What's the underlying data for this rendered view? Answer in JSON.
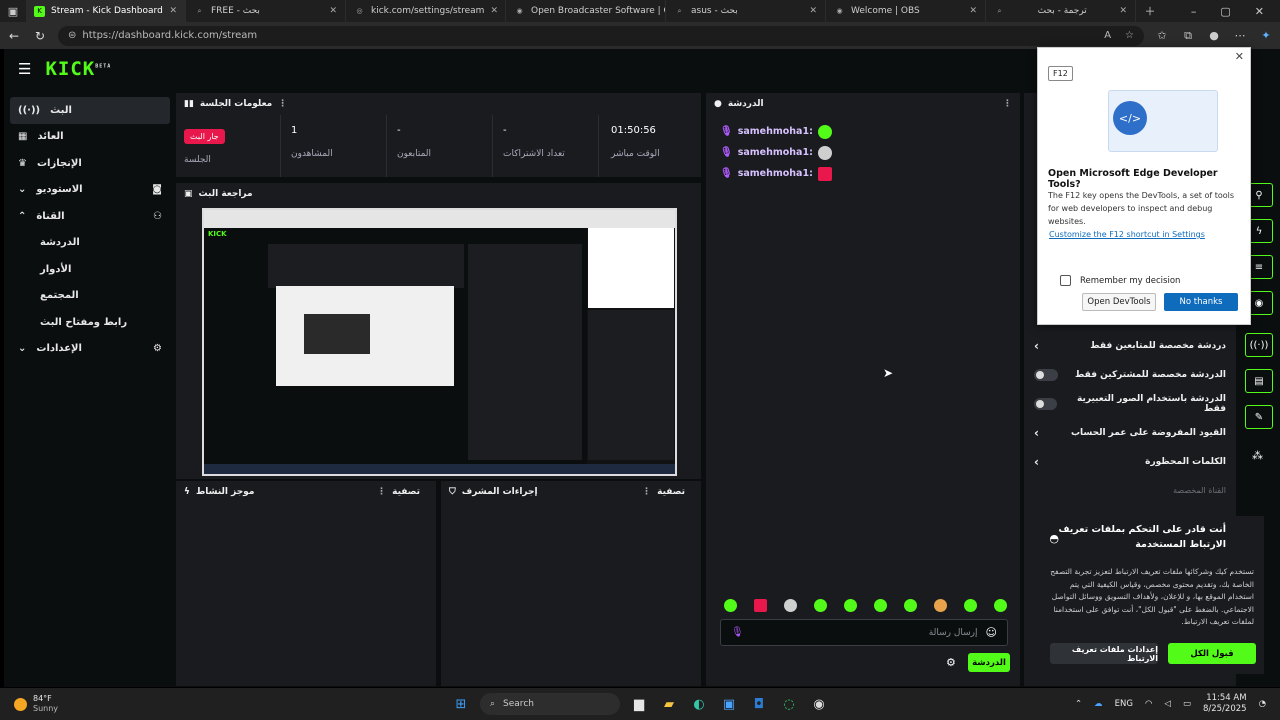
{
  "browser": {
    "tabs": [
      {
        "title": "Stream - Kick Dashboard",
        "favicon": "kick",
        "active": true
      },
      {
        "title": "FREE - بحث",
        "favicon": "search",
        "active": false
      },
      {
        "title": "kick.com/settings/stream",
        "favicon": "globe",
        "active": false
      },
      {
        "title": "Open Broadcaster Software | OBS",
        "favicon": "obs",
        "active": false
      },
      {
        "title": "asus - بحث",
        "favicon": "search",
        "active": false
      },
      {
        "title": "Welcome | OBS",
        "favicon": "obs",
        "active": false
      },
      {
        "title": "ترجمة - بحث",
        "favicon": "search",
        "active": false
      }
    ],
    "url": "https://dashboard.kick.com/stream"
  },
  "app": {
    "logo": "KICK",
    "logo_badge": "BETA"
  },
  "sidebar": {
    "items": [
      {
        "label": "البث",
        "icon": "broadcast-icon",
        "active": true
      },
      {
        "label": "العائد",
        "icon": "chart-icon"
      },
      {
        "label": "الإنجازات",
        "icon": "trophy-icon"
      },
      {
        "label": "الاستوديو",
        "icon": "camera-icon",
        "expand": "chevron-down"
      },
      {
        "label": "القناة",
        "icon": "users-icon",
        "expand": "chevron-up"
      },
      {
        "label": "الدردشة",
        "sub": true
      },
      {
        "label": "الأدوار",
        "sub": true
      },
      {
        "label": "المجتمع",
        "sub": true
      },
      {
        "label": "رابط ومفتاح البث",
        "sub": true
      },
      {
        "label": "الإعدادات",
        "icon": "gear-icon",
        "expand": "chevron-down"
      }
    ]
  },
  "session": {
    "title": "معلومات الجلسة",
    "live_badge": "جار البث",
    "session_label": "الجلسة",
    "stats": [
      {
        "value": "1",
        "label": "المشاهدون"
      },
      {
        "value": "-",
        "label": "المتابعون"
      },
      {
        "value": "-",
        "label": "تعداد الاشتراكات"
      },
      {
        "value": "01:50:56",
        "label": "الوقت مباشر"
      }
    ]
  },
  "preview": {
    "title": "مراجعة البث"
  },
  "activity": {
    "title": "موجز النشاط",
    "filter": "تصفية"
  },
  "modactions": {
    "title": "إجراءات المشرف",
    "filter": "تصفية"
  },
  "chat": {
    "title": "الدردشة",
    "messages": [
      {
        "user": "samehmoha1:"
      },
      {
        "user": "samehmoha1:"
      },
      {
        "user": "samehmoha1:"
      }
    ],
    "input_placeholder": "إرسال رسالة",
    "send_label": "الدردشة"
  },
  "chat_settings": {
    "rows": [
      {
        "label": "دردشة مخصصة للمتابعين فقط",
        "control": "chevron"
      },
      {
        "label": "الدردشة مخصصة للمشتركين فقط",
        "control": "toggle"
      },
      {
        "label": "الدردشة باستخدام الصور التعبيرية فقط",
        "control": "toggle"
      },
      {
        "label": "القيود المفروضة على عمر الحساب",
        "control": "chevron"
      },
      {
        "label": "الكلمات المحظورة",
        "control": "chevron"
      }
    ],
    "footer_text": "القناة المخصصة"
  },
  "devtools_popup": {
    "badge": "F12",
    "heading": "Open Microsoft Edge Developer Tools?",
    "body": "The F12 key opens the DevTools, a set of tools for web developers to inspect and debug websites.",
    "link": "Customize the F12 shortcut in Settings",
    "checkbox_label": "Remember my decision",
    "open_label": "Open DevTools",
    "no_label": "No thanks"
  },
  "cookie": {
    "heading": "أنت قادر على التحكم بملفات تعريف الارتباط المستخدمة",
    "body": "تستخدم كيك وشركائها ملفات تعريف الارتباط لتعزيز تجربة التصفح الخاصة بك، وتقديم محتوى مخصص، وقياس الكيفية التي يتم استخدام الموقع بها، و للإعلان، ولأهداف التسويق ووسائل التواصل الاجتماعي. بالضغط على \"قبول الكل\"، أنت توافق على استخدامنا لملفات تعريف الارتباط.",
    "settings_label": "إعدادات ملفات تعريف الارتباط",
    "accept_label": "قبول الكل"
  },
  "taskbar": {
    "weather_temp": "84°F",
    "weather_text": "Sunny",
    "search_label": "Search",
    "lang": "ENG",
    "time": "11:54 AM",
    "date": "8/25/2025"
  },
  "colors": {
    "accent": "#53fc18",
    "live": "#e8174c",
    "bg": "#0b0e0f",
    "panel": "#191b1f"
  }
}
